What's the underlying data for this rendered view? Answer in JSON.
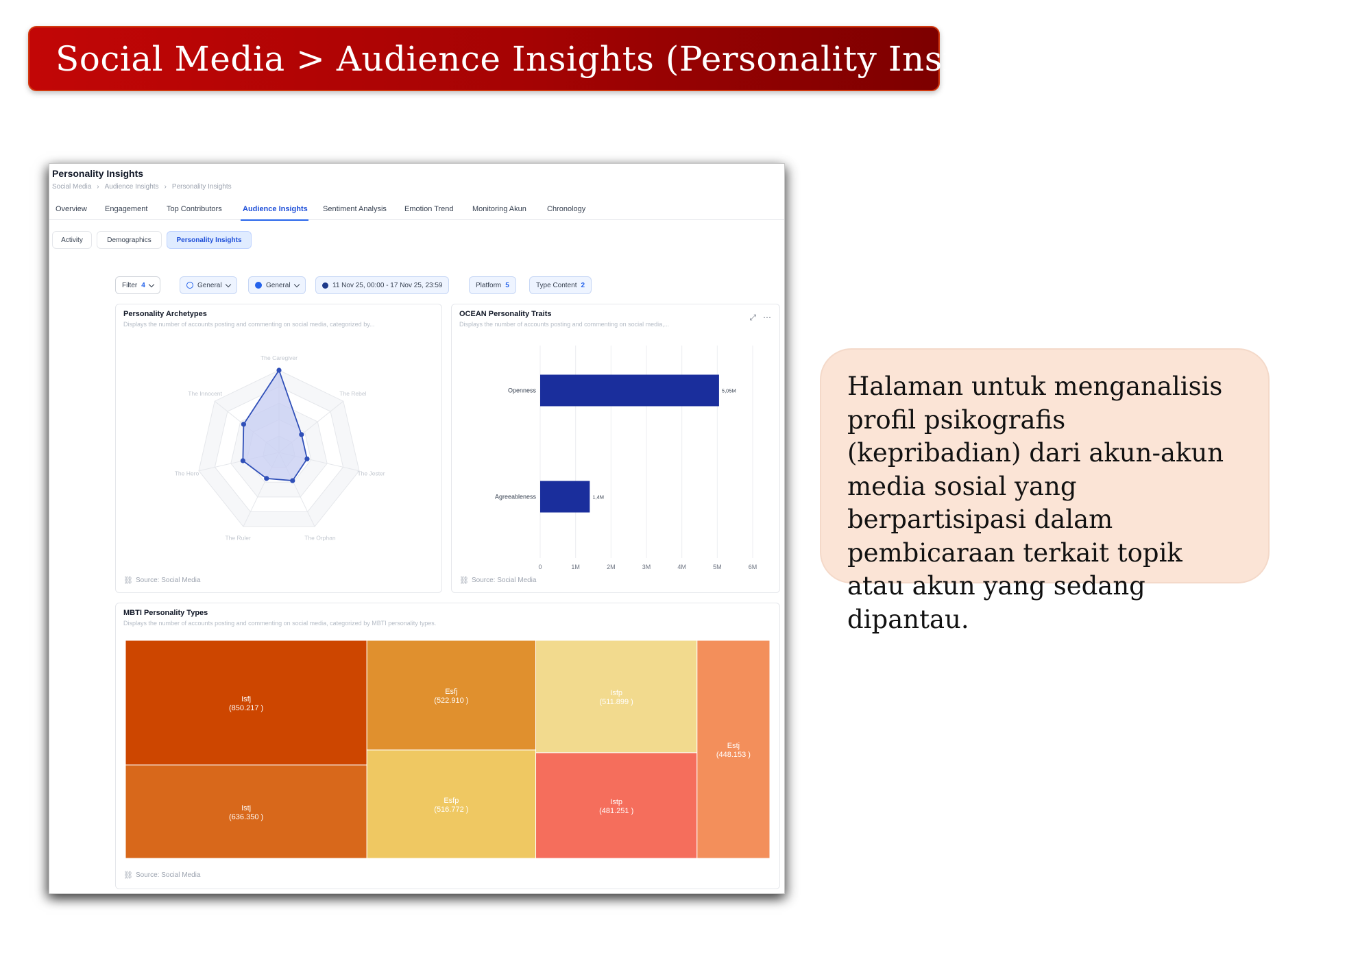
{
  "slide": {
    "title": "Social Media > Audience Insights (Personality Insights)",
    "description": "Halaman untuk menganalisis profil psikografis (kepribadian) dari akun-akun media sosial yang berpartisipasi dalam pembicaraan terkait topik atau akun yang sedang dipantau.",
    "banner_color": "#b30404",
    "callout_color": "#fbe4d6"
  },
  "app": {
    "page_title": "Personality Insights",
    "breadcrumb": [
      "Social Media",
      "Audience Insights",
      "Personality Insights"
    ],
    "tabs": [
      "Overview",
      "Engagement",
      "Top Contributors",
      "Audience Insights",
      "Sentiment Analysis",
      "Emotion Trend",
      "Monitoring Akun",
      "Chronology"
    ],
    "active_tab": "Audience Insights",
    "subtabs": [
      "Activity",
      "Demographics",
      "Personality Insights"
    ],
    "active_subtab": "Personality Insights",
    "filters": {
      "filter_label": "Filter",
      "filter_count": "4",
      "general_1": "General",
      "general_2": "General",
      "date_range": "11 Nov 25, 00:00 - 17 Nov 25, 23:59",
      "platform_label": "Platform",
      "platform_count": "5",
      "type_content_label": "Type Content",
      "type_content_count": "2"
    },
    "accent_color": "#2563eb"
  },
  "cards": {
    "archetypes": {
      "title": "Personality Archetypes",
      "subtitle": "Displays the number of accounts posting and commenting on social media, categorized by...",
      "source": "Source: Social Media"
    },
    "ocean": {
      "title": "OCEAN Personality Traits",
      "subtitle": "Displays the number of accounts posting and commenting on social media,...",
      "source": "Source: Social Media",
      "icons": [
        "expand-icon",
        "more-icon"
      ]
    },
    "mbti": {
      "title": "MBTI Personality Types",
      "subtitle": "Displays the number of accounts posting and commenting on social media, categorized by MBTI personality types.",
      "source": "Source: Social Media"
    }
  },
  "chart_data": [
    {
      "type": "radar",
      "axes": [
        "The Caregiver",
        "The Rebel",
        "The Jester",
        "The Orphan",
        "The Ruler",
        "The Hero",
        "The Innocent"
      ],
      "values": [
        1.0,
        0.35,
        0.35,
        0.38,
        0.35,
        0.45,
        0.55
      ],
      "rmax": 1.0,
      "color": "#2f4fb8",
      "fill": "#c9d0f2"
    },
    {
      "type": "bar",
      "orientation": "horizontal",
      "categories": [
        "Openness",
        "Agreeableness"
      ],
      "values": [
        5.05,
        1.4
      ],
      "value_labels": [
        "5,05M",
        "1,4M"
      ],
      "xticks": [
        "0",
        "1M",
        "2M",
        "3M",
        "4M",
        "5M",
        "6M"
      ],
      "xlim": [
        0,
        6
      ],
      "color": "#1a2e9c"
    },
    {
      "type": "treemap",
      "items": [
        {
          "label": "Isfj",
          "value_label": "(850.217 )",
          "value": 850217,
          "color": "#cd4600"
        },
        {
          "label": "Istj",
          "value_label": "(636.350 )",
          "value": 636350,
          "color": "#d8681b"
        },
        {
          "label": "Esfj",
          "value_label": "(522.910 )",
          "value": 522910,
          "color": "#e0902e"
        },
        {
          "label": "Esfp",
          "value_label": "(516.772 )",
          "value": 516772,
          "color": "#efc862"
        },
        {
          "label": "Isfp",
          "value_label": "(511.899 )",
          "value": 511899,
          "color": "#f2da8e"
        },
        {
          "label": "Istp",
          "value_label": "(481.251 )",
          "value": 481251,
          "color": "#f56e5c"
        },
        {
          "label": "Estj",
          "value_label": "(448.153 )",
          "value": 448153,
          "color": "#f38f5b"
        }
      ]
    }
  ]
}
